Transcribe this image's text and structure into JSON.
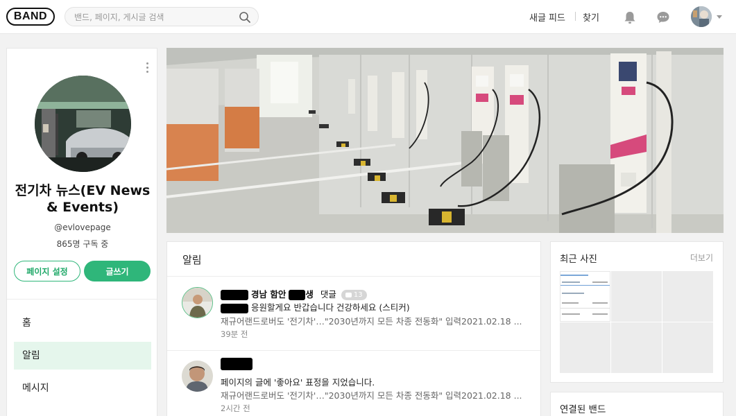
{
  "header": {
    "logo": "BAND",
    "search_placeholder": "밴드, 페이지, 게시글 검색",
    "nav_new_feed": "새글 피드",
    "nav_find": "찾기"
  },
  "profile": {
    "name": "전기차 뉴스(EV News & Events)",
    "handle": "@evlovepage",
    "subscribers": "865명 구독 중",
    "settings_button": "페이지 설정",
    "write_button": "글쓰기",
    "menu": [
      {
        "label": "홈",
        "active": false
      },
      {
        "label": "알림",
        "active": true
      },
      {
        "label": "메시지",
        "active": false
      }
    ]
  },
  "notifications": {
    "title": "알림",
    "items": [
      {
        "name_visible": "경남 함안",
        "name_suffix": "생",
        "action": "댓글",
        "comment_count": "13",
        "message": "응원할게요 반갑습니다 건강하세요 (스티커)",
        "post_excerpt": "재규어랜드로버도 '전기차'…\"2030년까지 모든 차종 전동화\" 입력2021.02.18 ...",
        "time": "39분 전"
      },
      {
        "message": "페이지의 글에 '좋아요' 표정을 지었습니다.",
        "post_excerpt": "재규어랜드로버도 '전기차'…\"2030년까지 모든 차종 전동화\" 입력2021.02.18 ...",
        "time": "2시간 전"
      }
    ]
  },
  "recent_photos": {
    "title": "최근 사진",
    "more": "더보기"
  },
  "linked_bands": {
    "title": "연결된 밴드"
  }
}
